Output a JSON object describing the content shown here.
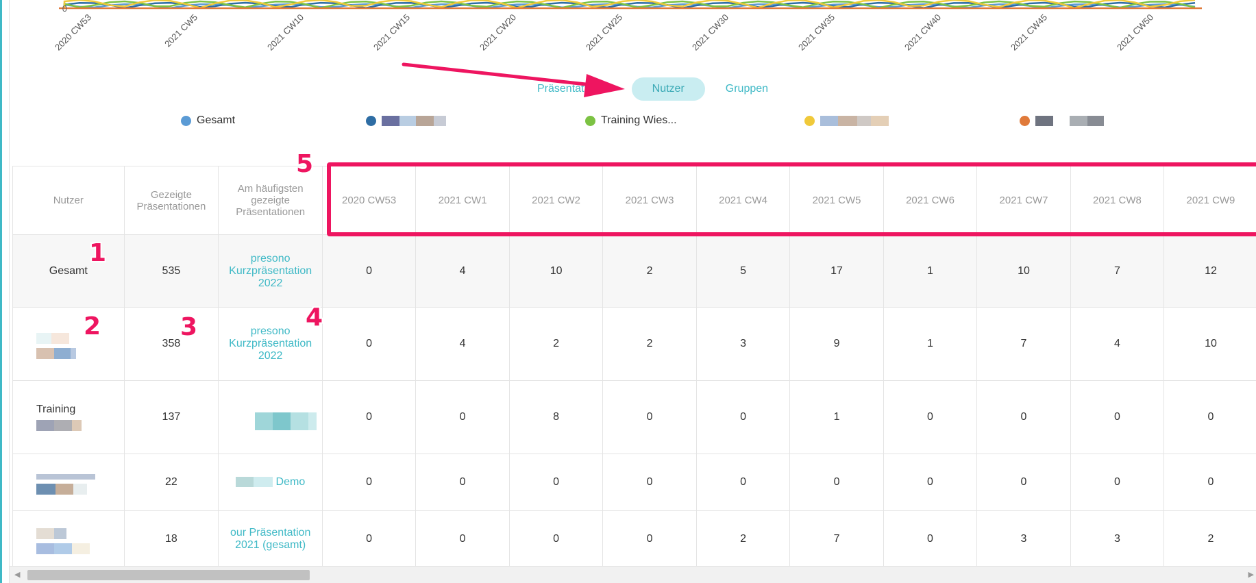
{
  "chart": {
    "y_zero_label": "0",
    "x_ticks": [
      "2020 CW53",
      "2021 CW5",
      "2021 CW10",
      "2021 CW15",
      "2021 CW20",
      "2021 CW25",
      "2021 CW30",
      "2021 CW35",
      "2021 CW40",
      "2021 CW45",
      "2021 CW50"
    ]
  },
  "toggle": {
    "presentations": "Präsentationen",
    "users": "Nutzer",
    "groups": "Gruppen",
    "active": "users"
  },
  "legend": [
    {
      "label": "Gesamt",
      "color": "#5b9bd5"
    },
    {
      "label": "",
      "color": "#2e6da4"
    },
    {
      "label": "Training Wies...",
      "color": "#7cc243"
    },
    {
      "label": "",
      "color": "#f0c93a"
    },
    {
      "label": "",
      "color": "#e07a3a"
    }
  ],
  "annotations": [
    "1",
    "2",
    "3",
    "4",
    "5"
  ],
  "table": {
    "headers": {
      "user": "Nutzer",
      "shown": "Gezeigte Präsentationen",
      "most_shown": "Am häufigsten gezeigte Präsentationen",
      "weeks": [
        "2020 CW53",
        "2021 CW1",
        "2021 CW2",
        "2021 CW3",
        "2021 CW4",
        "2021 CW5",
        "2021 CW6",
        "2021 CW7",
        "2021 CW8",
        "2021 CW9"
      ]
    },
    "rows": [
      {
        "user": "Gesamt",
        "shown": "535",
        "most": "presono Kurzpräsentation 2022",
        "weeks": [
          "0",
          "4",
          "10",
          "2",
          "5",
          "17",
          "1",
          "10",
          "7",
          "12"
        ]
      },
      {
        "user": "",
        "shown": "358",
        "most": "presono Kurzpräsentation 2022",
        "weeks": [
          "0",
          "4",
          "2",
          "2",
          "3",
          "9",
          "1",
          "7",
          "4",
          "10"
        ]
      },
      {
        "user": "Training",
        "shown": "137",
        "most": "",
        "weeks": [
          "0",
          "0",
          "8",
          "0",
          "0",
          "1",
          "0",
          "0",
          "0",
          "0"
        ]
      },
      {
        "user": "",
        "shown": "22",
        "most": "Demo",
        "weeks": [
          "0",
          "0",
          "0",
          "0",
          "0",
          "0",
          "0",
          "0",
          "0",
          "0"
        ]
      },
      {
        "user": "",
        "shown": "18",
        "most": "our Präsentation 2021 (gesamt)",
        "weeks": [
          "0",
          "0",
          "0",
          "0",
          "2",
          "7",
          "0",
          "3",
          "3",
          "2"
        ]
      }
    ]
  }
}
